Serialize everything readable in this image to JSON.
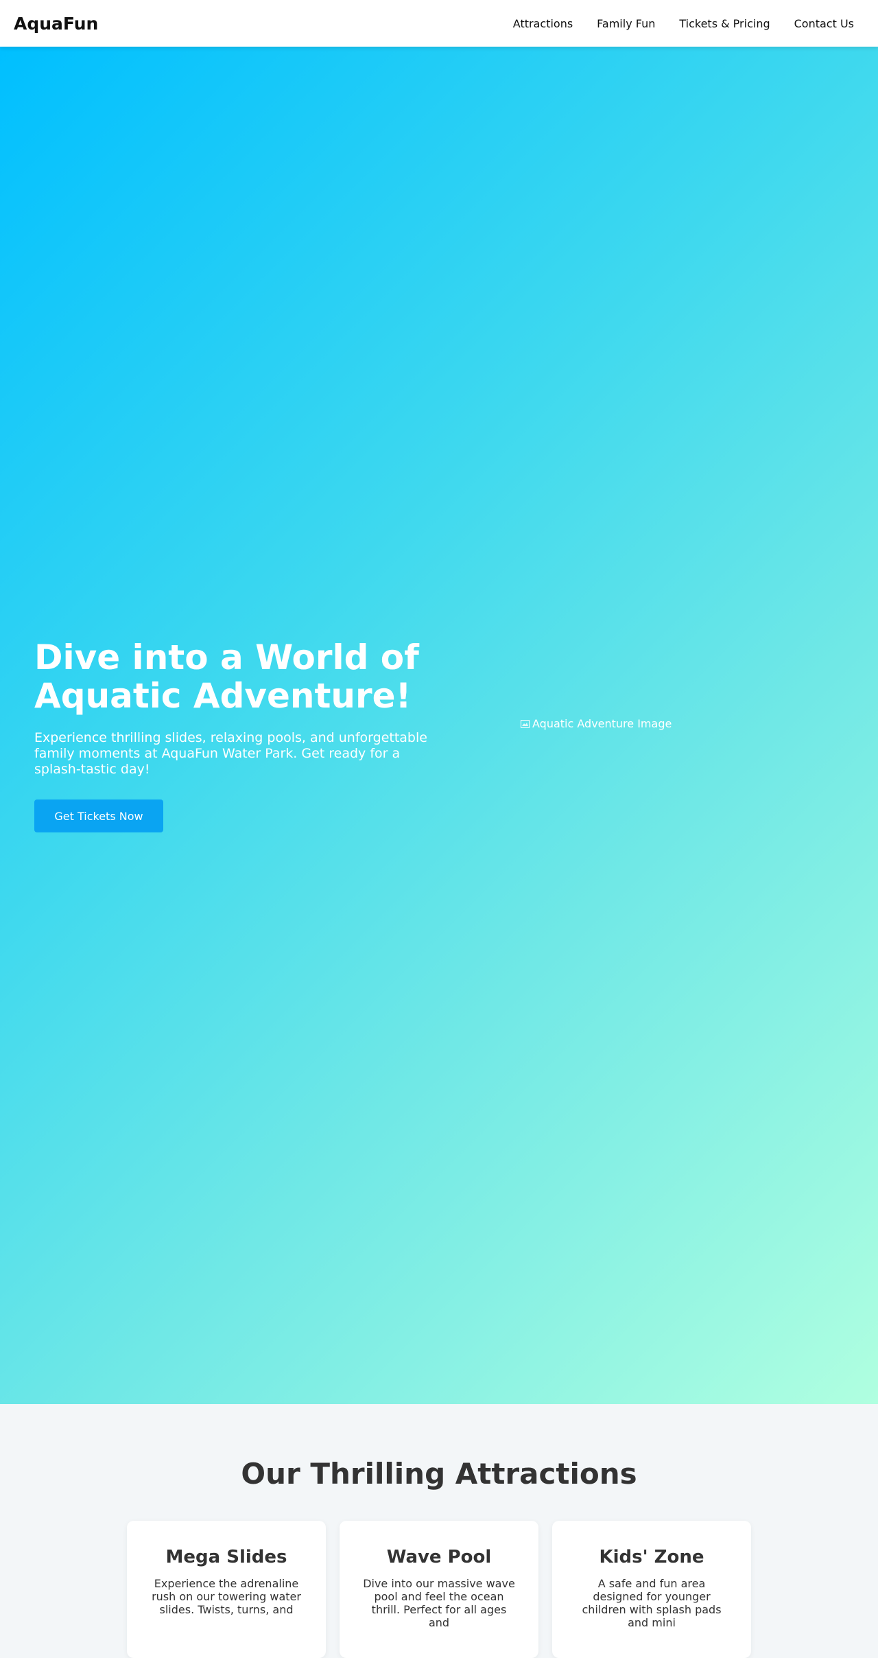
{
  "header": {
    "logo": "AquaFun",
    "nav": [
      {
        "label": "Attractions"
      },
      {
        "label": "Family Fun"
      },
      {
        "label": "Tickets & Pricing"
      },
      {
        "label": "Contact Us"
      }
    ]
  },
  "hero": {
    "title": "Dive into a World of Aquatic Adventure!",
    "subtitle": "Experience thrilling slides, relaxing pools, and unforgettable family moments at AquaFun Water Park. Get ready for a splash-tastic day!",
    "cta_label": "Get Tickets Now",
    "image_alt": "Aquatic Adventure Image"
  },
  "attractions": {
    "title": "Our Thrilling Attractions",
    "cards": [
      {
        "title": "Mega Slides",
        "text": "Experience the adrenaline rush on our towering water slides. Twists, turns, and"
      },
      {
        "title": "Wave Pool",
        "text": "Dive into our massive wave pool and feel the ocean thrill. Perfect for all ages and"
      },
      {
        "title": "Kids' Zone",
        "text": "A safe and fun area designed for younger children with splash pads and mini"
      }
    ]
  },
  "colors": {
    "gradient_start": "#00bfff",
    "gradient_end": "#b0ffe0",
    "cta": "#0aa4f2"
  }
}
